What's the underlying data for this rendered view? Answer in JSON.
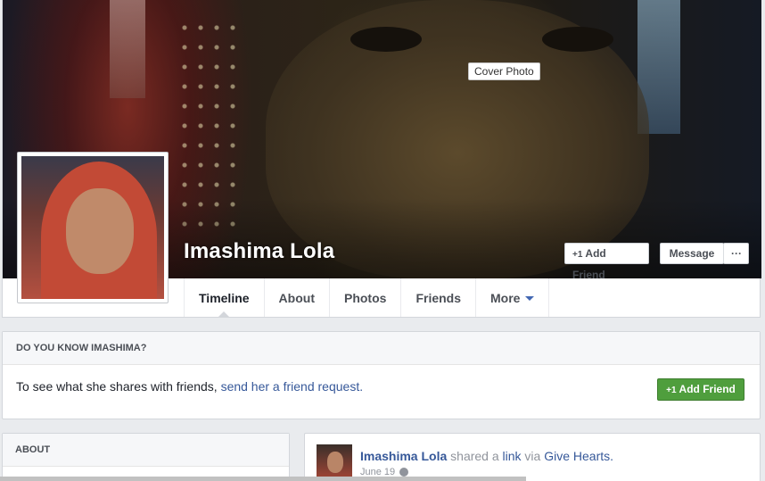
{
  "cover": {
    "tooltip": "Cover Photo"
  },
  "profile": {
    "name": "Imashima Lola"
  },
  "actions": {
    "add_friend": "Add Friend",
    "message": "Message",
    "more_dots": "···"
  },
  "tabs": [
    {
      "label": "Timeline",
      "active": true
    },
    {
      "label": "About"
    },
    {
      "label": "Photos"
    },
    {
      "label": "Friends"
    },
    {
      "label": "More"
    }
  ],
  "know": {
    "header": "DO YOU KNOW IMASHIMA?",
    "text": "To see what she shares with friends, ",
    "link": "send her a friend request.",
    "button": "Add Friend"
  },
  "about": {
    "header": "ABOUT"
  },
  "post": {
    "author": "Imashima Lola",
    "shared_a": " shared a ",
    "link_word": "link",
    "via": " via ",
    "app": "Give Hearts.",
    "date": "June 19"
  },
  "colors": {
    "link": "#365899",
    "green": "#4f9e3d"
  }
}
